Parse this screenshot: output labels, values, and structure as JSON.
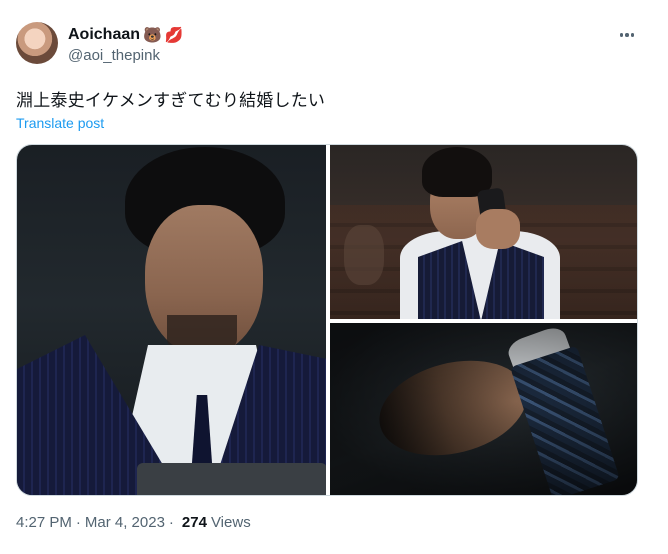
{
  "author": {
    "display_name": "Aoichaan",
    "emojis": [
      "🐻",
      "💋"
    ],
    "handle": "@aoi_thepink"
  },
  "tweet": {
    "text": "淵上泰史イケメンすぎてむり結婚したい",
    "translate_label": "Translate post"
  },
  "media": {
    "photo_count": 3
  },
  "meta": {
    "time": "4:27 PM",
    "separator": "·",
    "date": "Mar 4, 2023",
    "separator2": "·",
    "view_count": "274",
    "views_label": "Views"
  },
  "icons": {
    "more": "more-horizontal-icon"
  },
  "colors": {
    "link": "#1d9bf0",
    "secondary_text": "#536471",
    "primary_text": "#0f1419"
  }
}
